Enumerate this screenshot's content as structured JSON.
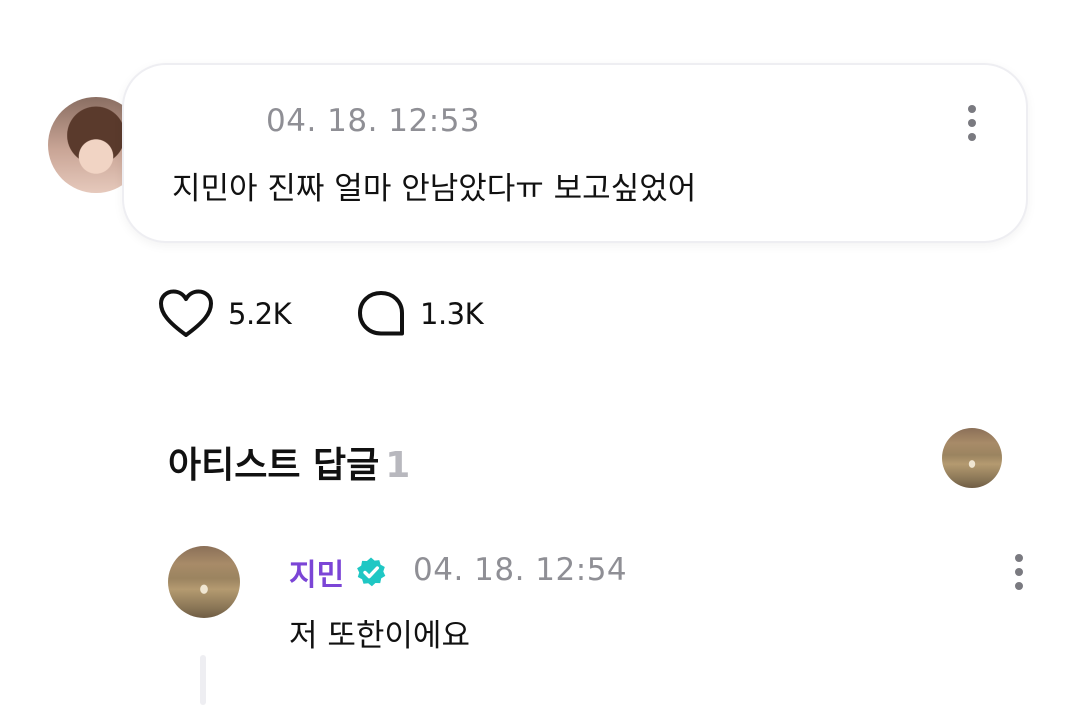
{
  "post": {
    "timestamp": "04. 18. 12:53",
    "text": "지민아 진짜 얼마 안남았다ㅠ 보고싶었어",
    "more_icon": "more-vertical-icon"
  },
  "reactions": {
    "likes": "5.2K",
    "comments": "1.3K",
    "like_icon": "heart-outline-icon",
    "comment_icon": "speech-bubble-icon"
  },
  "artist_replies": {
    "title": "아티스트 답글",
    "count": "1"
  },
  "reply": {
    "author": "지민",
    "timestamp": "04. 18. 12:54",
    "text": "저 또한이에요",
    "verified_color": "#1fc7c4",
    "author_color": "#7b45d6"
  }
}
